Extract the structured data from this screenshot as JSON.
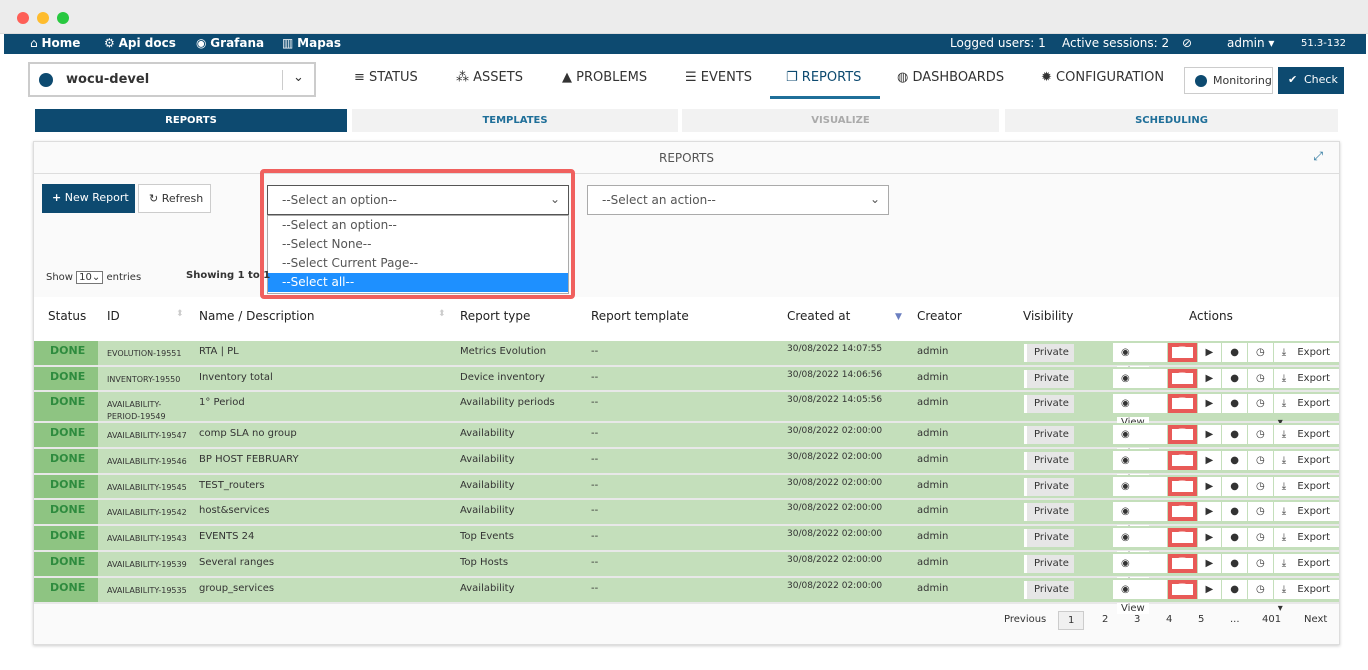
{
  "topbar": {
    "links": [
      "Home",
      "Api docs",
      "Grafana",
      "Mapas"
    ],
    "logged_users": "Logged users: 1",
    "active_sessions": "Active sessions: 2",
    "user": "admin",
    "version": "51.3-132"
  },
  "brand": {
    "name": "wocu-devel"
  },
  "nav": [
    "STATUS",
    "ASSETS",
    "PROBLEMS",
    "EVENTS",
    "REPORTS",
    "DASHBOARDS",
    "CONFIGURATION"
  ],
  "nav_active": "REPORTS",
  "buttons": {
    "monitoring": "Monitoring",
    "check": "Check",
    "new_report": "New Report",
    "refresh": "Refresh"
  },
  "subtabs": [
    "REPORTS",
    "TEMPLATES",
    "VISUALIZE",
    "SCHEDULING"
  ],
  "panel_title": "REPORTS",
  "select": {
    "value": "--Select an option--",
    "options": [
      "--Select an option--",
      "--Select None--",
      "--Select Current Page--",
      "--Select all--"
    ],
    "highlighted": "--Select all--"
  },
  "action_select": {
    "value": "--Select an action--"
  },
  "show": {
    "label_before": "Show",
    "value": "10",
    "label_after": "entries"
  },
  "showing": "Showing 1 to 1",
  "columns": [
    "Status",
    "ID",
    "Name / Description",
    "Report type",
    "Report template",
    "Created at",
    "Creator",
    "Visibility",
    "Actions"
  ],
  "rows": [
    {
      "status": "DONE",
      "id": "EVOLUTION-19551",
      "name": "RTA | PL",
      "type": "Metrics Evolution",
      "template": "--",
      "created": "30/08/2022 14:07:55",
      "creator": "admin",
      "visibility": "Private"
    },
    {
      "status": "DONE",
      "id": "INVENTORY-19550",
      "name": "Inventory total",
      "type": "Device inventory",
      "template": "--",
      "created": "30/08/2022 14:06:56",
      "creator": "admin",
      "visibility": "Private"
    },
    {
      "status": "DONE",
      "id": "AVAILABILITY-PERIOD-19549",
      "name": "1° Period",
      "type": "Availability periods",
      "template": "--",
      "created": "30/08/2022 14:05:56",
      "creator": "admin",
      "visibility": "Private"
    },
    {
      "status": "DONE",
      "id": "AVAILABILITY-19547",
      "name": "comp SLA no group",
      "type": "Availability",
      "template": "--",
      "created": "30/08/2022 02:00:00",
      "creator": "admin",
      "visibility": "Private"
    },
    {
      "status": "DONE",
      "id": "AVAILABILITY-19546",
      "name": "BP HOST FEBRUARY",
      "type": "Availability",
      "template": "--",
      "created": "30/08/2022 02:00:00",
      "creator": "admin",
      "visibility": "Private"
    },
    {
      "status": "DONE",
      "id": "AVAILABILITY-19545",
      "name": "TEST_routers",
      "type": "Availability",
      "template": "--",
      "created": "30/08/2022 02:00:00",
      "creator": "admin",
      "visibility": "Private"
    },
    {
      "status": "DONE",
      "id": "AVAILABILITY-19542",
      "name": "host&services",
      "type": "Availability",
      "template": "--",
      "created": "30/08/2022 02:00:00",
      "creator": "admin",
      "visibility": "Private"
    },
    {
      "status": "DONE",
      "id": "AVAILABILITY-19543",
      "name": "EVENTS 24",
      "type": "Top Events",
      "template": "--",
      "created": "30/08/2022 02:00:00",
      "creator": "admin",
      "visibility": "Private"
    },
    {
      "status": "DONE",
      "id": "AVAILABILITY-19539",
      "name": "Several ranges",
      "type": "Top Hosts",
      "template": "--",
      "created": "30/08/2022 02:00:00",
      "creator": "admin",
      "visibility": "Private"
    },
    {
      "status": "DONE",
      "id": "AVAILABILITY-19535",
      "name": "group_services",
      "type": "Availability",
      "template": "--",
      "created": "30/08/2022 02:00:00",
      "creator": "admin",
      "visibility": "Private"
    }
  ],
  "row_actions": {
    "view": "View",
    "export": "Export"
  },
  "pagination": {
    "previous": "Previous",
    "pages": [
      "1",
      "2",
      "3",
      "4",
      "5",
      "...",
      "401"
    ],
    "current": "1",
    "next": "Next"
  },
  "colors": {
    "primary": "#0d4a70",
    "done_row": "#c4dfbb",
    "delete": "#e85a57",
    "highlight": "#1e90ff"
  }
}
